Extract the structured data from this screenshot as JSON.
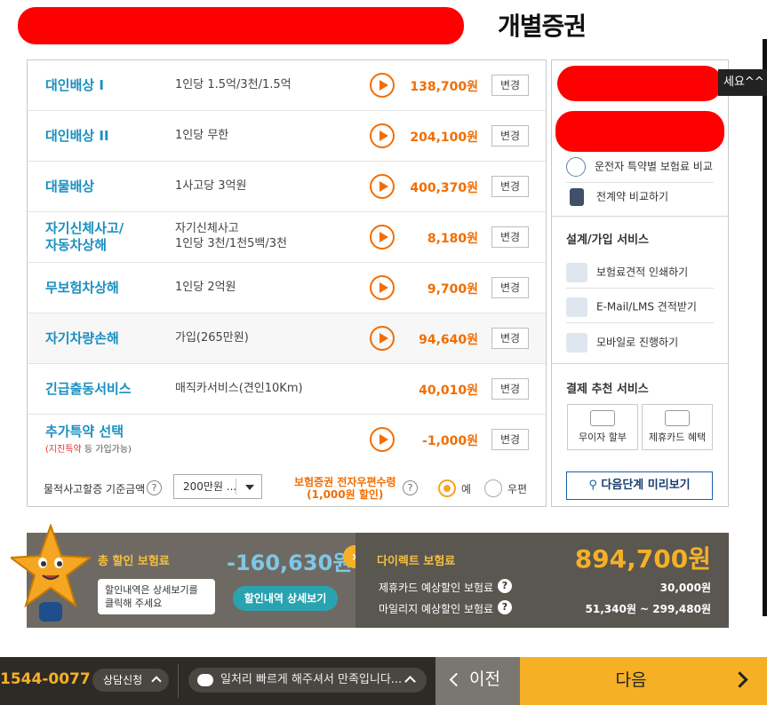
{
  "header": {
    "title": "개별증권"
  },
  "coverages": [
    {
      "name": "대인배상 I",
      "detail": "1인당 1.5억/3천/1.5억",
      "price": "138,700원",
      "change_label": "변경"
    },
    {
      "name": "대인배상 II",
      "detail": "1인당 무한",
      "price": "204,100원",
      "change_label": "변경"
    },
    {
      "name": "대물배상",
      "detail": "1사고당 3억원",
      "price": "400,370원",
      "change_label": "변경"
    },
    {
      "name_line1": "자기신체사고/",
      "name_line2": "자동차상해",
      "detail_line1": "자기신체사고",
      "detail_line2": "1인당 3천/1천5백/3천",
      "price": "8,180원",
      "change_label": "변경"
    },
    {
      "name": "무보험차상해",
      "detail": "1인당 2억원",
      "price": "9,700원",
      "change_label": "변경"
    },
    {
      "name": "자기차량손해",
      "detail": "가입(265만원)",
      "price": "94,640원",
      "change_label": "변경"
    },
    {
      "name": "긴급출동서비스",
      "detail": "매직카서비스(견인10Km)",
      "price": "40,010원",
      "change_label": "변경"
    },
    {
      "name": "추가특약 선택",
      "note_red": "(지진특약",
      "note_rest": " 등 가입가능)",
      "price": "-1,000원",
      "change_label": "변경"
    }
  ],
  "footer": {
    "deductible_label": "물적사고할증 기준금액",
    "deductible_value": "200만원 ...",
    "epost_line1": "보험증권 전자우편수령",
    "epost_line2": "(1,000원 할인)",
    "radio_yes": "예",
    "radio_mail": "우편",
    "help_glyph": "?"
  },
  "side": {
    "tooltip": "세요^^",
    "links": [
      "운전자 특약별 보험료 비교",
      "전계약 비교하기"
    ],
    "design_head": "설계/가입 서비스",
    "design_items": [
      "보험료견적 인쇄하기",
      "E-Mail/LMS 견적받기",
      "모바일로 진행하기"
    ],
    "pay_head": "결제 추천 서비스",
    "pay_options": [
      "무이자 할부",
      "제휴카드 혜택"
    ],
    "preview_label": "다음단계 미리보기"
  },
  "summary": {
    "total_discount_label": "총 할인 보험료",
    "total_discount_value": "-160,630원",
    "speech_line1": "할인내역은 상세보기를",
    "speech_line2": "클릭해 주세요",
    "detail_button": "할인내역 상세보기",
    "direct_label": "다이렉트 보험료",
    "direct_value": "894,700원",
    "card_label": "제휴카드 예상할인 보험료",
    "card_value": "30,000원",
    "mileage_label": "마일리지 예상할인 보험료",
    "mileage_value": "51,340원 ~ 299,480원",
    "arrow_glyph": "›",
    "help_glyph": "?"
  },
  "bottom": {
    "phone": "1544-0077",
    "consult": "상담신청",
    "chat": "일처리 빠르게 해주셔서 만족입니다...",
    "prev": "이전",
    "next": "다음"
  },
  "colors": {
    "accent_orange": "#f26d00",
    "title_blue": "#1a8fc1",
    "gold": "#f5b026",
    "summary_gray": "#6e6a63",
    "redaction": "#ff0000"
  }
}
